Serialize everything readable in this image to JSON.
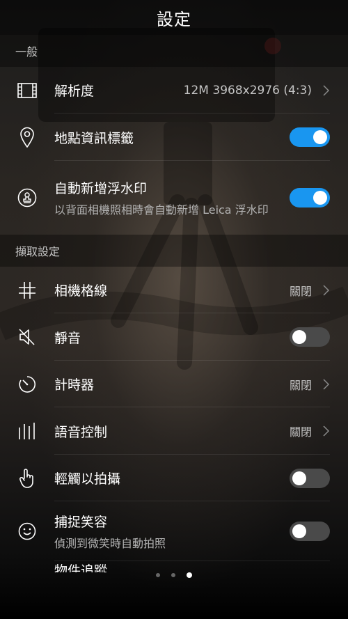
{
  "header": {
    "title": "設定"
  },
  "sections": {
    "general": "一般",
    "capture": "擷取設定"
  },
  "resolution": {
    "label": "解析度",
    "value": "12M 3968x2976 (4:3)"
  },
  "geotag": {
    "label": "地點資訊標籤",
    "state": "on"
  },
  "watermark": {
    "label": "自動新增浮水印",
    "description": "以背面相機照相時會自動新增 Leica 浮水印",
    "state": "on"
  },
  "grid": {
    "label": "相機格線",
    "value": "關閉"
  },
  "mute": {
    "label": "靜音",
    "state": "off"
  },
  "timer": {
    "label": "計時器",
    "value": "關閉"
  },
  "voice": {
    "label": "語音控制",
    "value": "關閉"
  },
  "touch": {
    "label": "輕觸以拍攝",
    "state": "off"
  },
  "smile": {
    "label": "捕捉笑容",
    "description": "偵測到微笑時自動拍照",
    "state": "off"
  },
  "partial_item": {
    "label": "物件追蹤"
  },
  "pager": {
    "count": 3,
    "active": 3
  },
  "colors": {
    "accent": "#1996f0",
    "toggle_off": "#4a4a4a"
  }
}
